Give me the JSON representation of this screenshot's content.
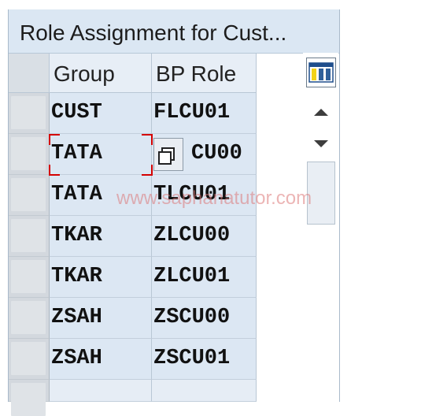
{
  "window": {
    "title": "Role Assignment for Cust..."
  },
  "table": {
    "columns": [
      "Group",
      "BP Role"
    ],
    "rows": [
      {
        "group": "CUST",
        "role": "FLCU01"
      },
      {
        "group": "TATA",
        "role": "CU00"
      },
      {
        "group": "TATA",
        "role": "TLCU01"
      },
      {
        "group": "TKAR",
        "role": "ZLCU00"
      },
      {
        "group": "TKAR",
        "role": "ZLCU01"
      },
      {
        "group": "ZSAH",
        "role": "ZSCU00"
      },
      {
        "group": "ZSAH",
        "role": "ZSCU01"
      }
    ]
  },
  "watermark": "www.saphanatutor.com",
  "icons": {
    "column_settings": "column-settings-icon",
    "value_help": "f4-value-help-icon",
    "scroll_up": "scroll-up-icon",
    "scroll_down": "scroll-down-icon"
  },
  "colors": {
    "header_bg": "#dbe7f3",
    "cell_bg": "#dce7f3",
    "focus": "#d40000"
  }
}
